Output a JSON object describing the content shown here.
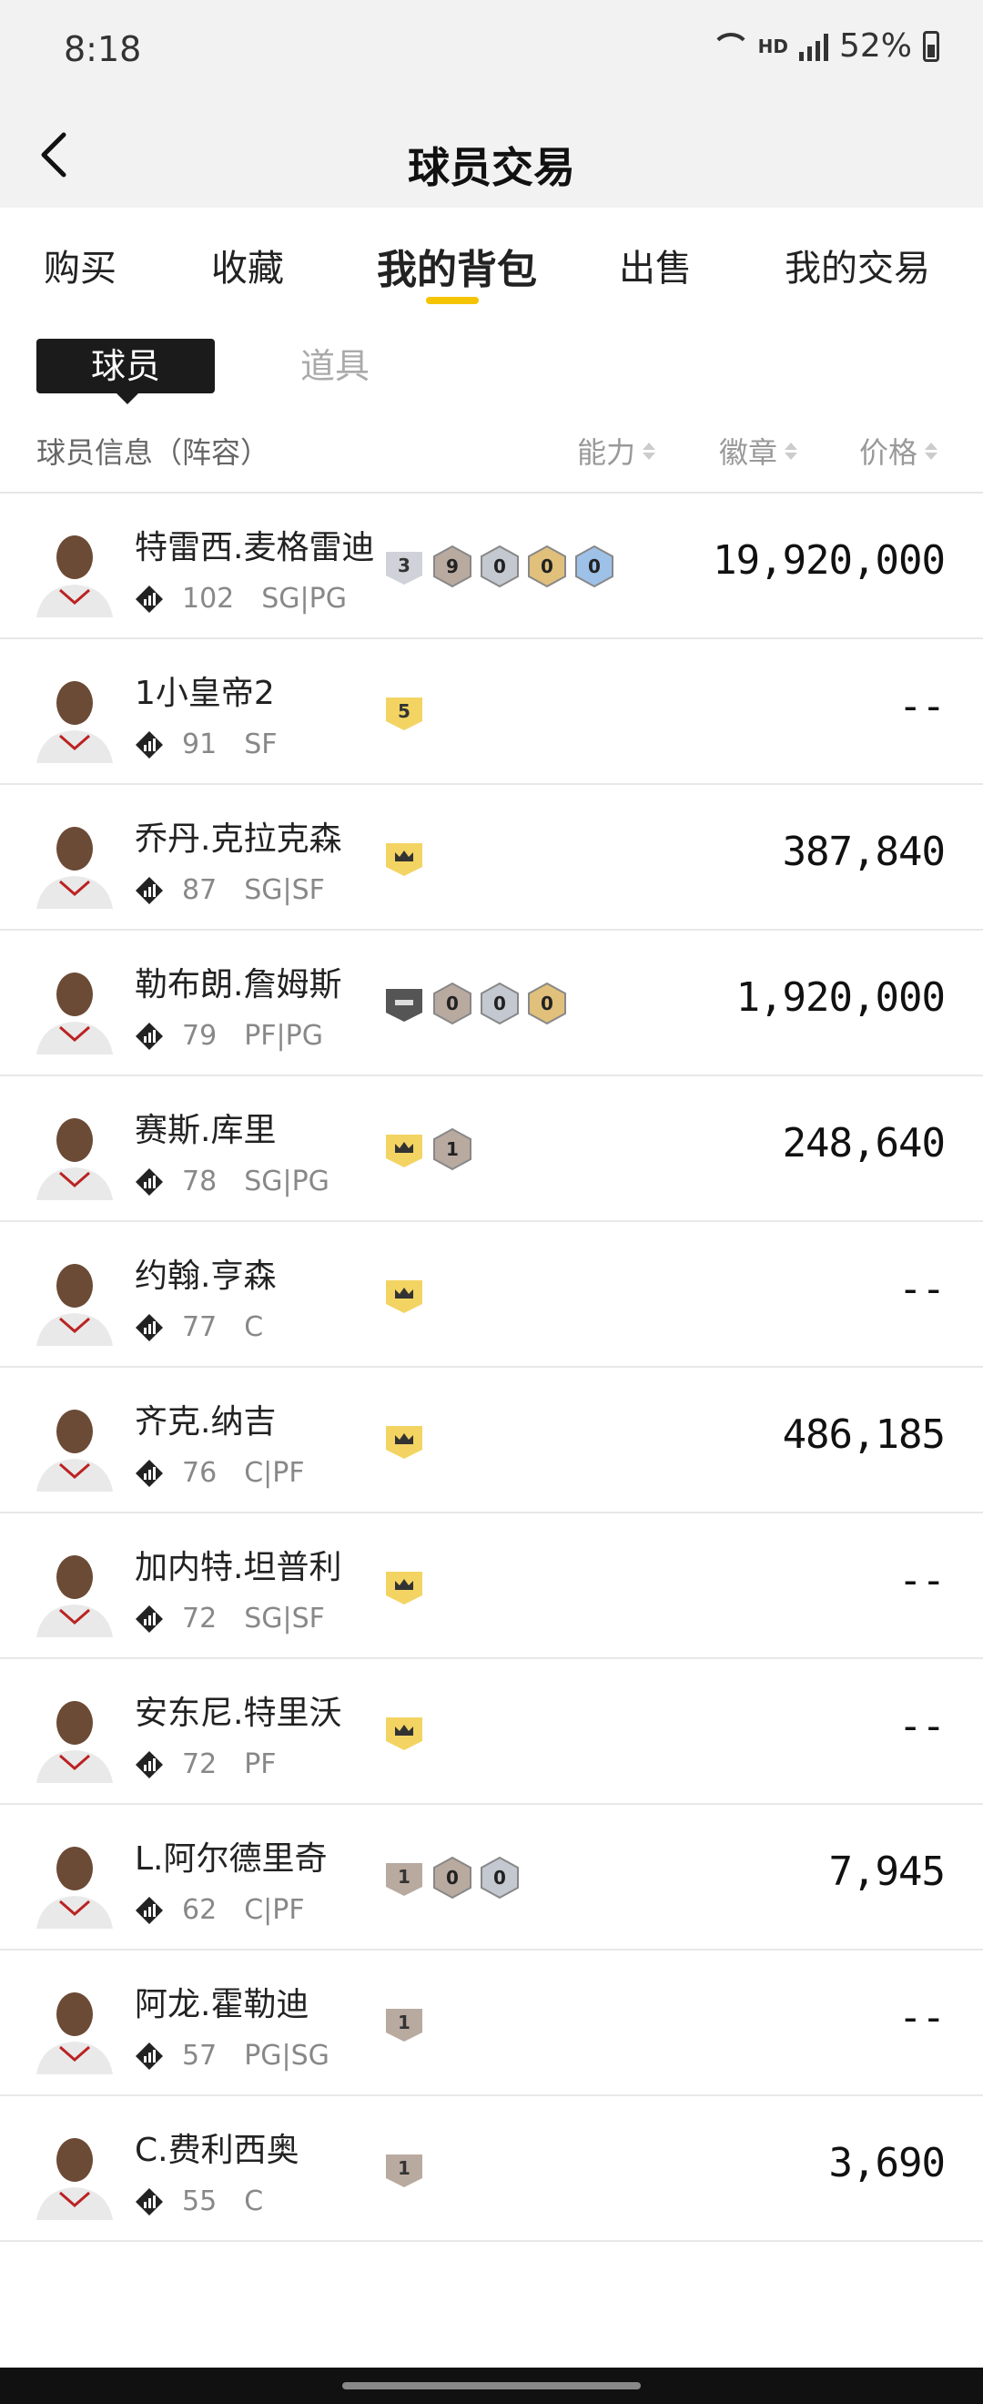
{
  "status_bar": {
    "time": "8:18",
    "network": "HD",
    "battery": "52%"
  },
  "header": {
    "title": "球员交易"
  },
  "tabs": [
    {
      "label": "购买",
      "active": false
    },
    {
      "label": "收藏",
      "active": false
    },
    {
      "label": "我的背包",
      "active": true
    },
    {
      "label": "出售",
      "active": false
    },
    {
      "label": "我的交易",
      "active": false
    }
  ],
  "segments": {
    "players": "球员",
    "items": "道具"
  },
  "table_header": {
    "info": "球员信息（阵容）",
    "ability": "能力",
    "badge": "徽章",
    "price": "价格"
  },
  "players": [
    {
      "name": "特雷西.麦格雷迪",
      "rating": "102",
      "position": "SG|PG",
      "badge_tier": "3",
      "badges": [
        "9",
        "0",
        "0",
        "0"
      ],
      "price": "19,920,000",
      "tier_icon": "04"
    },
    {
      "name": "1小皇帝2",
      "rating": "91",
      "position": "SF",
      "badge_tier": "5",
      "badges": [],
      "price": "--",
      "tier_icon": ""
    },
    {
      "name": "乔丹.克拉克森",
      "rating": "87",
      "position": "SG|SF",
      "badge_tier": "crown",
      "badges": [],
      "price": "387,840",
      "tier_icon": ""
    },
    {
      "name": "勒布朗.詹姆斯",
      "rating": "79",
      "position": "PF|PG",
      "badge_tier": "minus",
      "badges": [
        "0",
        "0",
        "0"
      ],
      "price": "1,920,000",
      "tier_icon": ""
    },
    {
      "name": "赛斯.库里",
      "rating": "78",
      "position": "SG|PG",
      "badge_tier": "crown",
      "badges": [
        "1"
      ],
      "price": "248,640",
      "tier_icon": ""
    },
    {
      "name": "约翰.亨森",
      "rating": "77",
      "position": "C",
      "badge_tier": "crown",
      "badges": [],
      "price": "--",
      "tier_icon": ""
    },
    {
      "name": "齐克.纳吉",
      "rating": "76",
      "position": "C|PF",
      "badge_tier": "crown",
      "badges": [],
      "price": "486,185",
      "tier_icon": ""
    },
    {
      "name": "加内特.坦普利",
      "rating": "72",
      "position": "SG|SF",
      "badge_tier": "crown",
      "badges": [],
      "price": "--",
      "tier_icon": ""
    },
    {
      "name": "安东尼.特里沃",
      "rating": "72",
      "position": "PF",
      "badge_tier": "crown",
      "badges": [],
      "price": "--",
      "tier_icon": ""
    },
    {
      "name": "L.阿尔德里奇",
      "rating": "62",
      "position": "C|PF",
      "badge_tier": "1",
      "badges": [
        "0",
        "0"
      ],
      "price": "7,945",
      "tier_icon": ""
    },
    {
      "name": "阿龙.霍勒迪",
      "rating": "57",
      "position": "PG|SG",
      "badge_tier": "1",
      "badges": [],
      "price": "--",
      "tier_icon": ""
    },
    {
      "name": "C.费利西奥",
      "rating": "55",
      "position": "C",
      "badge_tier": "1",
      "badges": [],
      "price": "3,690",
      "tier_icon": ""
    }
  ],
  "colors": {
    "accent": "#f5c400",
    "crown_badge": "#f3d463",
    "bronze": "#b9aaa0",
    "silver": "#c4c8d0",
    "gold": "#e1c07c",
    "blue": "#9ec1e8"
  }
}
